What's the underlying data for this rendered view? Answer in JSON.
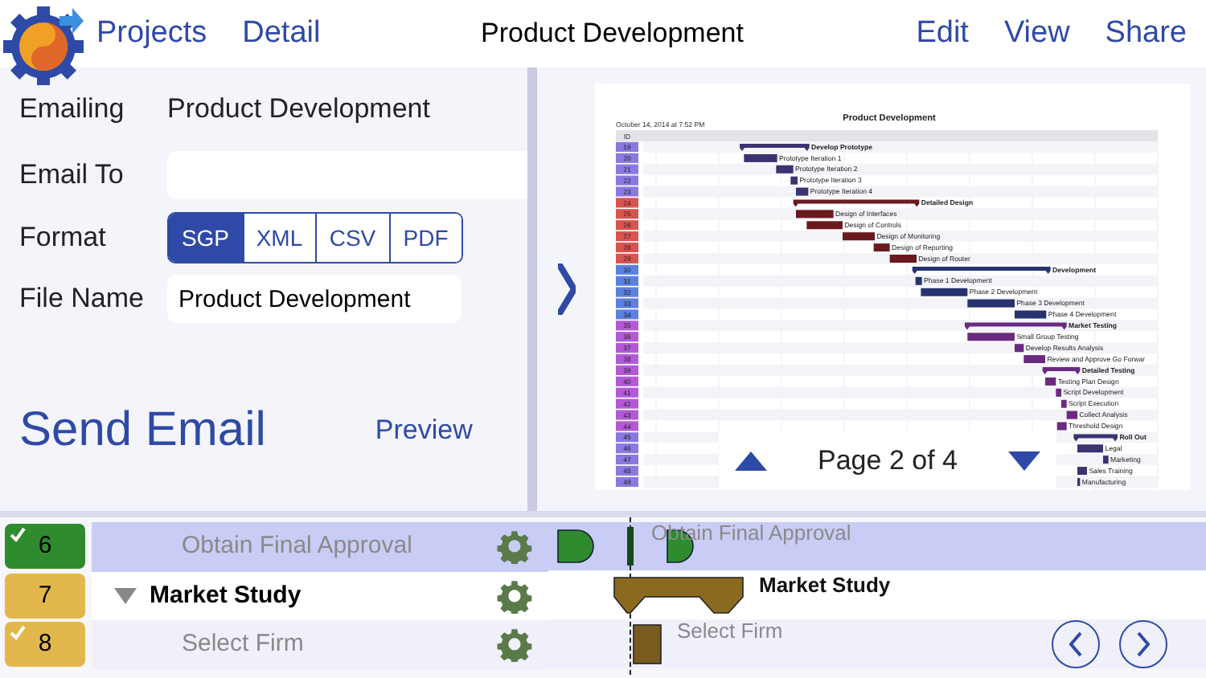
{
  "nav": {
    "back": "Projects",
    "detail": "Detail",
    "title": "Product Development",
    "actions": [
      "Edit",
      "View",
      "Share"
    ]
  },
  "email_form": {
    "emailing_label": "Emailing",
    "emailing_value": "Product Development",
    "email_to_label": "Email To",
    "format_label": "Format",
    "formats": [
      {
        "label": "SGP",
        "selected": true
      },
      {
        "label": "XML",
        "selected": false
      },
      {
        "label": "CSV",
        "selected": false
      },
      {
        "label": "PDF",
        "selected": false
      }
    ],
    "file_name_label": "File Name",
    "file_name_value": "Product Development",
    "send_button": "Send Email",
    "preview_link": "Preview"
  },
  "preview": {
    "title": "Product Development",
    "timestamp": "October 14, 2014 at 7:52 PM",
    "id_header": "ID",
    "page_label": "Page 2 of 4",
    "tasks": [
      {
        "id": "19",
        "name": "Develop Prototype",
        "summary": true,
        "color": "#8b78e0"
      },
      {
        "id": "20",
        "name": "Prototype Iteration 1",
        "summary": false,
        "color": "#8b78e0"
      },
      {
        "id": "21",
        "name": "Prototype Iteration 2",
        "summary": false,
        "color": "#8b78e0"
      },
      {
        "id": "22",
        "name": "Prototype Iteration 3",
        "summary": false,
        "color": "#8b78e0"
      },
      {
        "id": "23",
        "name": "Prototype Iteration 4",
        "summary": false,
        "color": "#8b78e0"
      },
      {
        "id": "24",
        "name": "Detailed Design",
        "summary": true,
        "color": "#d9534f"
      },
      {
        "id": "25",
        "name": "Design of Interfaces",
        "summary": false,
        "color": "#d9534f"
      },
      {
        "id": "26",
        "name": "Design of Controls",
        "summary": false,
        "color": "#d9534f"
      },
      {
        "id": "27",
        "name": "Design of Monitoring",
        "summary": false,
        "color": "#d9534f"
      },
      {
        "id": "28",
        "name": "Design of Reporting",
        "summary": false,
        "color": "#d9534f"
      },
      {
        "id": "29",
        "name": "Design of Router",
        "summary": false,
        "color": "#d9534f"
      },
      {
        "id": "30",
        "name": "Development",
        "summary": true,
        "color": "#5b80e0"
      },
      {
        "id": "31",
        "name": "Phase 1 Development",
        "summary": false,
        "color": "#5b80e0"
      },
      {
        "id": "32",
        "name": "Phase 2 Development",
        "summary": false,
        "color": "#5b80e0"
      },
      {
        "id": "33",
        "name": "Phase 3 Development",
        "summary": false,
        "color": "#5b80e0"
      },
      {
        "id": "34",
        "name": "Phase 4 Development",
        "summary": false,
        "color": "#5b80e0"
      },
      {
        "id": "35",
        "name": "Market Testing",
        "summary": true,
        "color": "#b25ad6"
      },
      {
        "id": "36",
        "name": "Small Group Testing",
        "summary": false,
        "color": "#b25ad6"
      },
      {
        "id": "37",
        "name": "Develop Results Analysis",
        "summary": false,
        "color": "#b25ad6"
      },
      {
        "id": "38",
        "name": "Review and Approve Go Forwar",
        "summary": false,
        "color": "#b25ad6"
      },
      {
        "id": "39",
        "name": "Detailed Testing",
        "summary": true,
        "color": "#b25ad6"
      },
      {
        "id": "40",
        "name": "Testing Plan Design",
        "summary": false,
        "color": "#b25ad6"
      },
      {
        "id": "41",
        "name": "Script Development",
        "summary": false,
        "color": "#b25ad6"
      },
      {
        "id": "42",
        "name": "Script Execution",
        "summary": false,
        "color": "#b25ad6"
      },
      {
        "id": "43",
        "name": "Collect Analysis",
        "summary": false,
        "color": "#b25ad6"
      },
      {
        "id": "44",
        "name": "Threshold Design",
        "summary": false,
        "color": "#b25ad6"
      },
      {
        "id": "45",
        "name": "Roll Out",
        "summary": true,
        "color": "#8b78e0"
      },
      {
        "id": "46",
        "name": "Legal",
        "summary": false,
        "color": "#8b78e0"
      },
      {
        "id": "47",
        "name": "Marketing",
        "summary": false,
        "color": "#8b78e0"
      },
      {
        "id": "48",
        "name": "Sales Training",
        "summary": false,
        "color": "#8b78e0"
      },
      {
        "id": "49",
        "name": "Manufacturing",
        "summary": false,
        "color": "#8b78e0"
      }
    ]
  },
  "tasks": [
    {
      "kind": "milestone",
      "number": "6",
      "name": "Obtain Final Approval",
      "chart_label": "Obtain Final Approval",
      "checked": true,
      "selected": true,
      "color": "#2e8b2e"
    },
    {
      "kind": "summary",
      "number": "7",
      "name": "Market Study",
      "chart_label": "Market Study",
      "checked": false,
      "selected": false,
      "expanded": true,
      "color": "#e2b84c"
    },
    {
      "kind": "task",
      "number": "8",
      "name": "Select Firm",
      "chart_label": "Select Firm",
      "checked": true,
      "selected": false,
      "color": "#e2b84c"
    }
  ]
}
